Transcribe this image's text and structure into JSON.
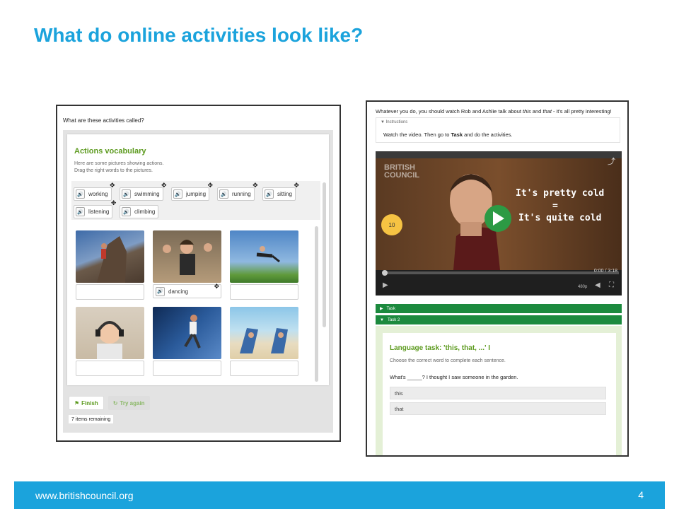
{
  "slide": {
    "title": "What do online activities look like?",
    "footer_url": "www.britishcouncil.org",
    "page_number": "4"
  },
  "left_activity": {
    "question": "What are these activities called?",
    "card_title": "Actions vocabulary",
    "description_line1": "Here are some pictures showing actions.",
    "description_line2": "Drag the right words to the pictures.",
    "words": [
      "working",
      "swimming",
      "jumping",
      "running",
      "sitting",
      "listening",
      "climbing"
    ],
    "placed_word": "dancing",
    "pictures": [
      "rock-climber-photo",
      "dancers-photo",
      "jumping-man-photo",
      "boy-with-headphones-photo",
      "runner-photo",
      "beach-chairs-photo"
    ],
    "finish_label": "Finish",
    "try_again_label": "Try again",
    "remaining_label": "7 items remaining"
  },
  "right_activity": {
    "header_prefix": "Whatever you do, you should watch Rob and Ashlie talk about ",
    "header_this": "this",
    "header_and": " and ",
    "header_that": "that",
    "header_suffix": " - it's all pretty interesting!",
    "instructions_label": "Instructions",
    "instructions_prefix": "Watch the video. Then go to ",
    "instructions_bold": "Task",
    "instructions_suffix": " and do the activities.",
    "video": {
      "logo_line1": "BRITISH",
      "logo_line2": "COUNCIL",
      "line1": "It's pretty cold",
      "equals": "=",
      "line2": "It's quite cold",
      "timer": "10",
      "time": "0:00 / 3:18",
      "quality": "480p"
    },
    "task_label": "Task",
    "task2_label": "Task 2",
    "task_title": "Language task: 'this, that, ...' I",
    "task_instructions": "Choose the correct word to complete each sentence.",
    "task_question": "What's _____? I thought I saw someone in the garden.",
    "options": [
      "this",
      "that"
    ]
  },
  "colors": {
    "accent": "#1ba3dc",
    "green_title": "#5c9a1e",
    "task_bar": "#1c8a3e",
    "play_button": "#2c9a44"
  }
}
